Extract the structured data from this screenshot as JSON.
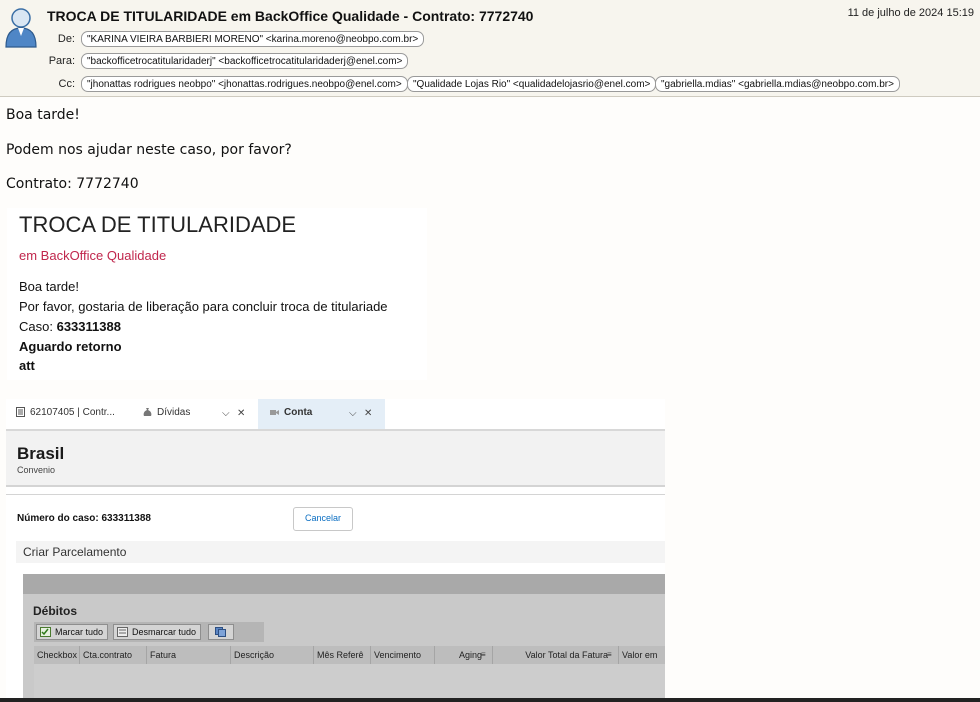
{
  "email": {
    "subject": "TROCA DE TITULARIDADE em BackOffice Qualidade - Contrato: 7772740",
    "date": "11 de julho de 2024 15:19",
    "from_label": "De:",
    "to_label": "Para:",
    "cc_label": "Cc:",
    "from": "\"KARINA VIEIRA BARBIERI MORENO\" <karina.moreno@neobpo.com.br>",
    "to": "\"backofficetrocatitularidaderj\" <backofficetrocatitularidaderj@enel.com>",
    "cc": [
      "\"jhonattas rodrigues neobpo\" <jhonattas.rodrigues.neobpo@enel.com>",
      "\"Qualidade Lojas Rio\" <qualidadelojasrio@enel.com>",
      "\"gabriella.mdias\" <gabriella.mdias@neobpo.com.br>"
    ]
  },
  "body": {
    "greeting": "Boa tarde!",
    "request": "Podem nos ajudar neste caso, por favor?",
    "contract": "Contrato: 7772740"
  },
  "card": {
    "title": "TROCA DE TITULARIDADE",
    "subtitle": "em BackOffice Qualidade",
    "line1": "Boa tarde!",
    "line2": "Por favor, gostaria de liberação para concluir troca de titulariade",
    "case_label": "Caso:",
    "case_value": "633311388",
    "line4": "Aguardo retorno",
    "line5": "att"
  },
  "screenshot": {
    "tabs": [
      "62107405 | Contr...",
      "Dívidas",
      "Conta"
    ],
    "header_title": "Brasil",
    "header_subtitle": "Convenio",
    "case_text": "Número do caso: 633311388",
    "cancel_label": "Cancelar",
    "section": "Criar Parcelamento",
    "debitos_title": "Débitos",
    "toolbar": {
      "mark_all": "Marcar tudo",
      "unmark_all": "Desmarcar tudo"
    },
    "columns": [
      "Checkbox",
      "Cta.contrato",
      "Fatura",
      "Descrição",
      "Mês Referê",
      "Vencimento",
      "Aging",
      "Valor Total da Fatura",
      "Valor em"
    ]
  },
  "colors": {
    "card_subtitle": "#c0264c",
    "link": "#0b6ec2",
    "active_tab": "#e4eef7"
  }
}
